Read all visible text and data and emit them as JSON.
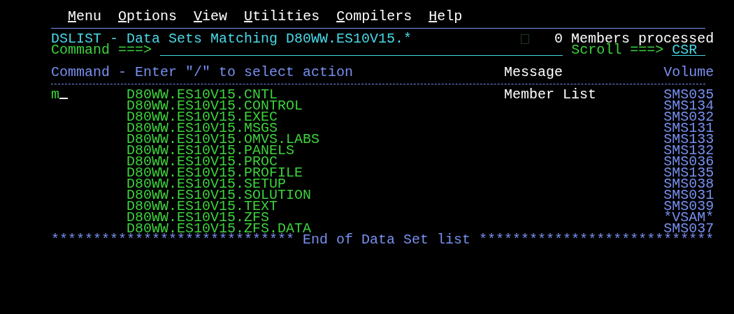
{
  "menu_bar": [
    {
      "label": "Menu"
    },
    {
      "label": "Options"
    },
    {
      "label": "View"
    },
    {
      "label": "Utilities"
    },
    {
      "label": "Compilers"
    },
    {
      "label": "Help"
    }
  ],
  "panel": {
    "title": "DSLIST - Data Sets Matching D80WW.ES10V15.*",
    "status": "0 Members processed",
    "command_label": "Command ===>",
    "scroll_label": "Scroll ===>",
    "scroll_value": "CSR"
  },
  "list": {
    "header": {
      "command": "Command - Enter \"/\" to select action",
      "message": "Message",
      "volume": "Volume"
    },
    "rows": [
      {
        "command": "m",
        "cursor": true,
        "name": "D80WW.ES10V15.CNTL",
        "message": "Member List",
        "volume": "SMS035"
      },
      {
        "cursor": false,
        "name": "D80WW.ES10V15.CONTROL",
        "volume": "SMS134"
      },
      {
        "cursor": false,
        "name": "D80WW.ES10V15.EXEC",
        "volume": "SMS032"
      },
      {
        "cursor": false,
        "name": "D80WW.ES10V15.MSGS",
        "volume": "SMS131"
      },
      {
        "cursor": false,
        "name": "D80WW.ES10V15.OMVS.LABS",
        "volume": "SMS133"
      },
      {
        "cursor": false,
        "name": "D80WW.ES10V15.PANELS",
        "volume": "SMS132"
      },
      {
        "cursor": false,
        "name": "D80WW.ES10V15.PROC",
        "volume": "SMS036"
      },
      {
        "cursor": false,
        "name": "D80WW.ES10V15.PROFILE",
        "volume": "SMS135"
      },
      {
        "cursor": false,
        "name": "D80WW.ES10V15.SETUP",
        "volume": "SMS038"
      },
      {
        "cursor": false,
        "name": "D80WW.ES10V15.SOLUTION",
        "volume": "SMS031"
      },
      {
        "cursor": false,
        "name": "D80WW.ES10V15.TEXT",
        "volume": "SMS039"
      },
      {
        "cursor": false,
        "name": "D80WW.ES10V15.ZFS",
        "volume": "*VSAM*"
      },
      {
        "cursor": false,
        "name": "D80WW.ES10V15.ZFS.DATA",
        "volume": "SMS037"
      }
    ],
    "footer": "***************************** End of Data Set list ****************************"
  }
}
